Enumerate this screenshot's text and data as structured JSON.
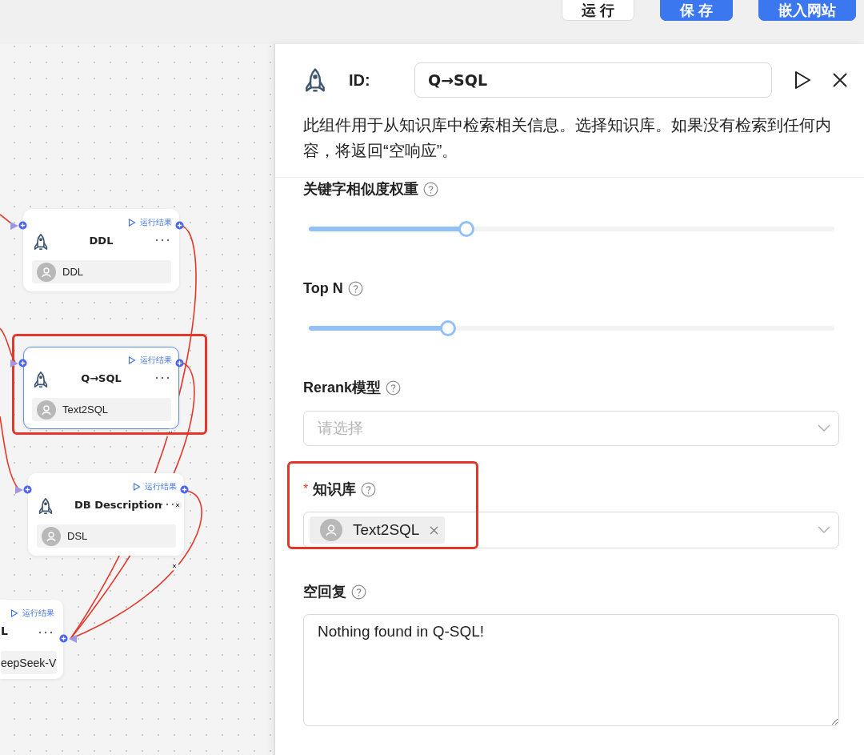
{
  "toolbar": {
    "buttons": [
      {
        "label": "运 行",
        "kind": "default"
      },
      {
        "label": "保 存",
        "kind": "primary"
      },
      {
        "label": "嵌入网站",
        "kind": "primary"
      }
    ]
  },
  "canvas": {
    "nodes": [
      {
        "kind": "full",
        "title": "DDL",
        "run_label": "运行结果",
        "chip": "DDL",
        "selected": false,
        "highlighted": false
      },
      {
        "kind": "full",
        "title": "Q→SQL",
        "run_label": "运行结果",
        "chip": "Text2SQL",
        "selected": true,
        "highlighted": true
      },
      {
        "kind": "full",
        "title": "DB Description",
        "run_label": "运行结果",
        "chip": "DSL",
        "selected": false,
        "highlighted": false
      },
      {
        "kind": "partial",
        "title": "L",
        "run_label": "运行结果",
        "chip": "eepSeek-V",
        "selected": false,
        "highlighted": false
      }
    ]
  },
  "panel": {
    "id_label": "ID:",
    "id_value": "Q→SQL",
    "description": "此组件用于从知识库中检索相关信息。选择知识库。如果没有检索到任何内容，将返回“空响应”。",
    "fields": [
      {
        "kind": "slider",
        "label": "关键字相似度权重",
        "level": 0.3
      },
      {
        "kind": "slider",
        "label": "Top N",
        "level": 0.265
      },
      {
        "kind": "select",
        "label": "Rerank模型",
        "placeholder": "请选择"
      },
      {
        "kind": "tags",
        "label": "知识库",
        "required_mark": "*",
        "highlighted": true,
        "tags": [
          {
            "label": "Text2SQL"
          }
        ]
      },
      {
        "kind": "textarea",
        "label": "空回复",
        "value": "Nothing found in Q-SQL!"
      }
    ]
  }
}
